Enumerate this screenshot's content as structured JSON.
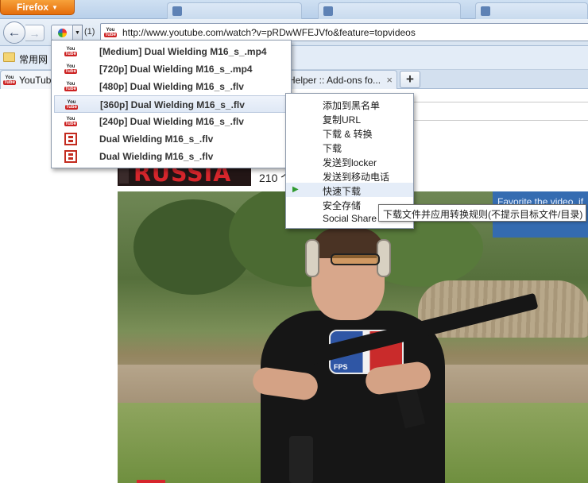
{
  "browser": {
    "app_button": "Firefox",
    "download_count": "(1)",
    "url": "http://www.youtube.com/watch?v=pRDwWFEJVfo&feature=topvideos",
    "bookmarks": [
      {
        "label": "常用网"
      }
    ],
    "tabs": [
      {
        "label": "YouTube",
        "active": true
      },
      {
        "label": "Helper :: Add-ons fo..."
      }
    ],
    "new_tab": "+",
    "close_glyph": "×"
  },
  "download_menu": {
    "items": [
      {
        "label": "[Medium] Dual Wielding M16_s_.mp4",
        "icon": "youtube-icon"
      },
      {
        "label": "[720p] Dual Wielding M16_s_.mp4",
        "icon": "youtube-icon"
      },
      {
        "label": "[480p] Dual Wielding M16_s_.flv",
        "icon": "youtube-icon"
      },
      {
        "label": "[360p] Dual Wielding M16_s_.flv",
        "icon": "youtube-icon",
        "highlighted": true
      },
      {
        "label": "[240p] Dual Wielding M16_s_.flv",
        "icon": "youtube-icon"
      },
      {
        "label": "Dual Wielding M16_s_.flv",
        "icon": "film-icon"
      },
      {
        "label": "Dual Wielding M16_s_.flv",
        "icon": "film-icon"
      }
    ]
  },
  "context_menu": {
    "items": [
      {
        "label": "添加到黑名单"
      },
      {
        "label": "复制URL"
      },
      {
        "label": "下载 & 转换"
      },
      {
        "label": "下载"
      },
      {
        "label": "发送到locker"
      },
      {
        "label": "发送到移动电话"
      },
      {
        "label": "快速下载",
        "highlighted": true,
        "icon": "play-icon"
      },
      {
        "label": "安全存储"
      },
      {
        "label": "Social Share"
      }
    ]
  },
  "tooltip": "下载文件并应用转换规则(不提示目标文件/目录)",
  "page": {
    "logo_text": "RUSSIA",
    "views": "210 个",
    "overlay_text": "Favorite the video, if",
    "shirt_text": "FPS"
  },
  "icons": {
    "youtube_you": "You",
    "youtube_tube": "Tube"
  },
  "colors": {
    "firefox_orange": "#e56d0b",
    "youtube_red": "#cc2222",
    "menu_highlight": "#dfe8f5"
  }
}
